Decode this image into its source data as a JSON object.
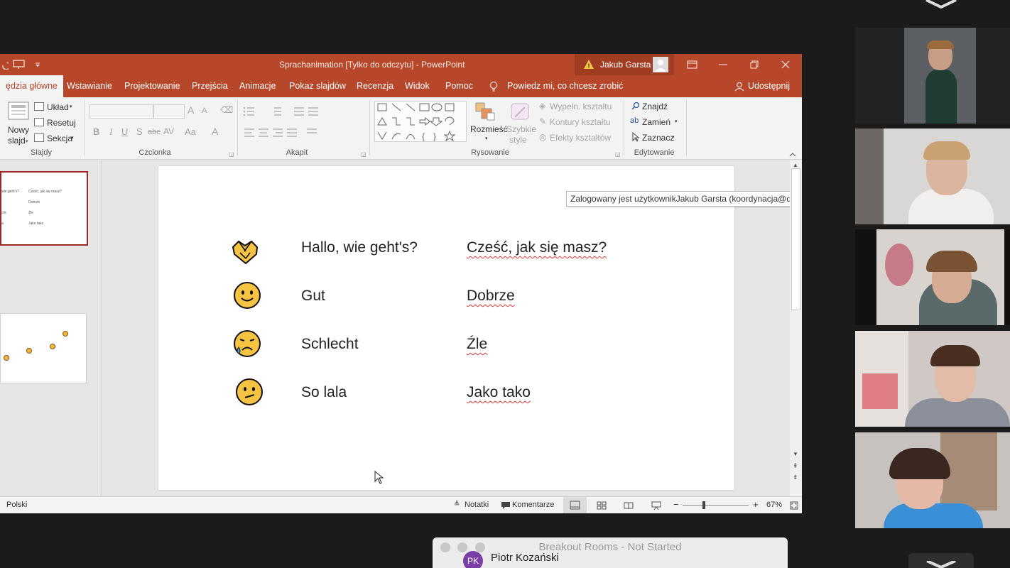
{
  "window": {
    "title": "Sprachanimation [Tylko do odczytu]  -  PowerPoint",
    "user": "Jakub Garsta"
  },
  "tabs": [
    "ędzia główne",
    "Wstawianie",
    "Projektowanie",
    "Przejścia",
    "Animacje",
    "Pokaz slajdów",
    "Recenzja",
    "Widok",
    "Pomoc"
  ],
  "tellme": "Powiedz mi, co chcesz zrobić",
  "share": "Udostępnij",
  "ribbon": {
    "slides": {
      "group": "Slajdy",
      "new_slide_1": "Nowy",
      "new_slide_2": "slajd",
      "layout": "Układ",
      "reset": "Resetuj",
      "section": "Sekcja"
    },
    "font": {
      "group": "Czcionka",
      "bold": "B",
      "italic": "I",
      "underline": "U",
      "shadow": "S",
      "strike": "abc",
      "spacing": "AV",
      "case": "Aa",
      "grow": "A",
      "shrink": "A",
      "color": "A"
    },
    "paragraph": {
      "group": "Akapit"
    },
    "drawing": {
      "group": "Rysowanie",
      "arrange": "Rozmieść",
      "quick1": "Szybkie",
      "quick2": "style",
      "fill": "Wypełn. kształtu",
      "outline": "Kontury kształtu",
      "effects": "Efekty kształtów"
    },
    "editing": {
      "group": "Edytowanie",
      "find": "Znajdź",
      "replace": "Zamień",
      "select": "Zaznacz"
    }
  },
  "thumb1": {
    "r1a": "wie geht's?",
    "r1b": "Cześć, jak się masz?",
    "r2b": "Dobrze",
    "r3a": "cht",
    "r3b": "Źle",
    "r4a": "a",
    "r4b": "Jako tako"
  },
  "slide": {
    "rows": [
      {
        "de": "Hallo, wie geht's?",
        "pl": "Cześć, jak się masz?",
        "icon": "handshake-emoji"
      },
      {
        "de": "Gut",
        "pl": "Dobrze",
        "icon": "smiling-face-emoji"
      },
      {
        "de": "Schlecht",
        "pl": "Źle",
        "icon": "sad-tear-face-emoji"
      },
      {
        "de": "So lala",
        "pl": "Jako tako",
        "icon": "confused-face-emoji"
      }
    ]
  },
  "tooltip": "Zalogowany jest użytkownikJakub Garsta (koordynacja@dmk.pl)",
  "status": {
    "language": "Polski",
    "notes": "Notatki",
    "comments": "Komentarze",
    "zoom": "67%"
  },
  "breakout": {
    "title": "Breakout Rooms - Not Started",
    "initials": "PK",
    "name": "Piotr Kozański"
  },
  "colors": {
    "accent": "#b7472a",
    "zoom_bg": "#1b1b1b"
  }
}
